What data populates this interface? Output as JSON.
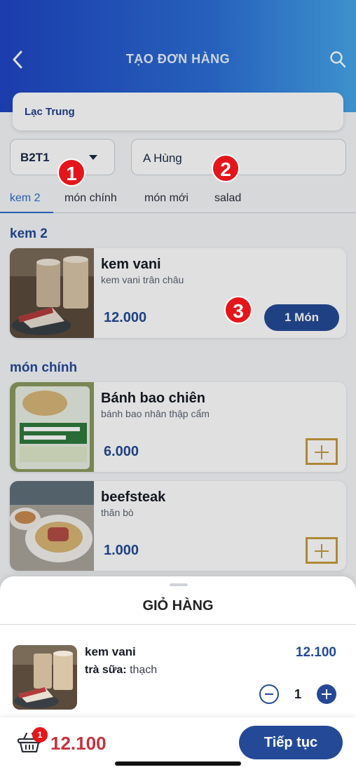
{
  "header": {
    "title": "TẠO ĐƠN HÀNG",
    "back_icon": "chevron-left-icon",
    "search_icon": "search-icon",
    "gradient": [
      "#1f45c4",
      "#46a6ea"
    ]
  },
  "customer": {
    "name": "Lạc Trung"
  },
  "table_select": {
    "value": "B2T1"
  },
  "staff": {
    "value": "A Hùng"
  },
  "tabs": [
    {
      "label": "kem 2",
      "active": true
    },
    {
      "label": "món chính",
      "active": false
    },
    {
      "label": "món mới",
      "active": false
    },
    {
      "label": "salad",
      "active": false
    }
  ],
  "badges": [
    "1",
    "2",
    "3"
  ],
  "sections": [
    {
      "title": "kem 2",
      "products": [
        {
          "name": "kem vani",
          "desc": "kem vani trân châu",
          "price": "12.000",
          "qty_label": "1 Món"
        }
      ]
    },
    {
      "title": "món chính",
      "products": [
        {
          "name": "Bánh bao chiên",
          "desc": "bánh bao nhân thập cẩm",
          "price": "6.000"
        },
        {
          "name": "beefsteak",
          "desc": "thăn bò",
          "price": "1.000"
        }
      ]
    }
  ],
  "cart_sheet": {
    "title": "GIỎ HÀNG",
    "item": {
      "name": "kem vani",
      "option_label": "trà sữa:",
      "option_value": "thạch",
      "price": "12.100",
      "quantity": "1"
    }
  },
  "footer": {
    "cart_count": "1",
    "total": "12.100",
    "continue_label": "Tiếp tục"
  },
  "colors": {
    "primary": "#244a97",
    "accent_gold": "#c79b3c",
    "badge_red": "#e5161b",
    "total_red": "#c7323b"
  }
}
